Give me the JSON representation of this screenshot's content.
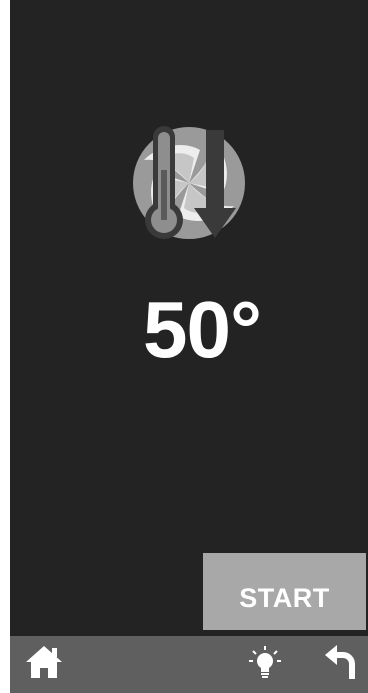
{
  "display": {
    "temperature": "50°",
    "mode_icon": "convection-thermometer-icon"
  },
  "actions": {
    "start_label": "START"
  },
  "bottom_bar": {
    "icons": [
      "home-icon",
      "light-bulb-icon",
      "back-arrow-icon"
    ]
  },
  "colors": {
    "screen_background": "#232323",
    "start_button": "#a8a8a8",
    "bottom_bar": "#5f5f5f",
    "text": "#ffffff"
  }
}
